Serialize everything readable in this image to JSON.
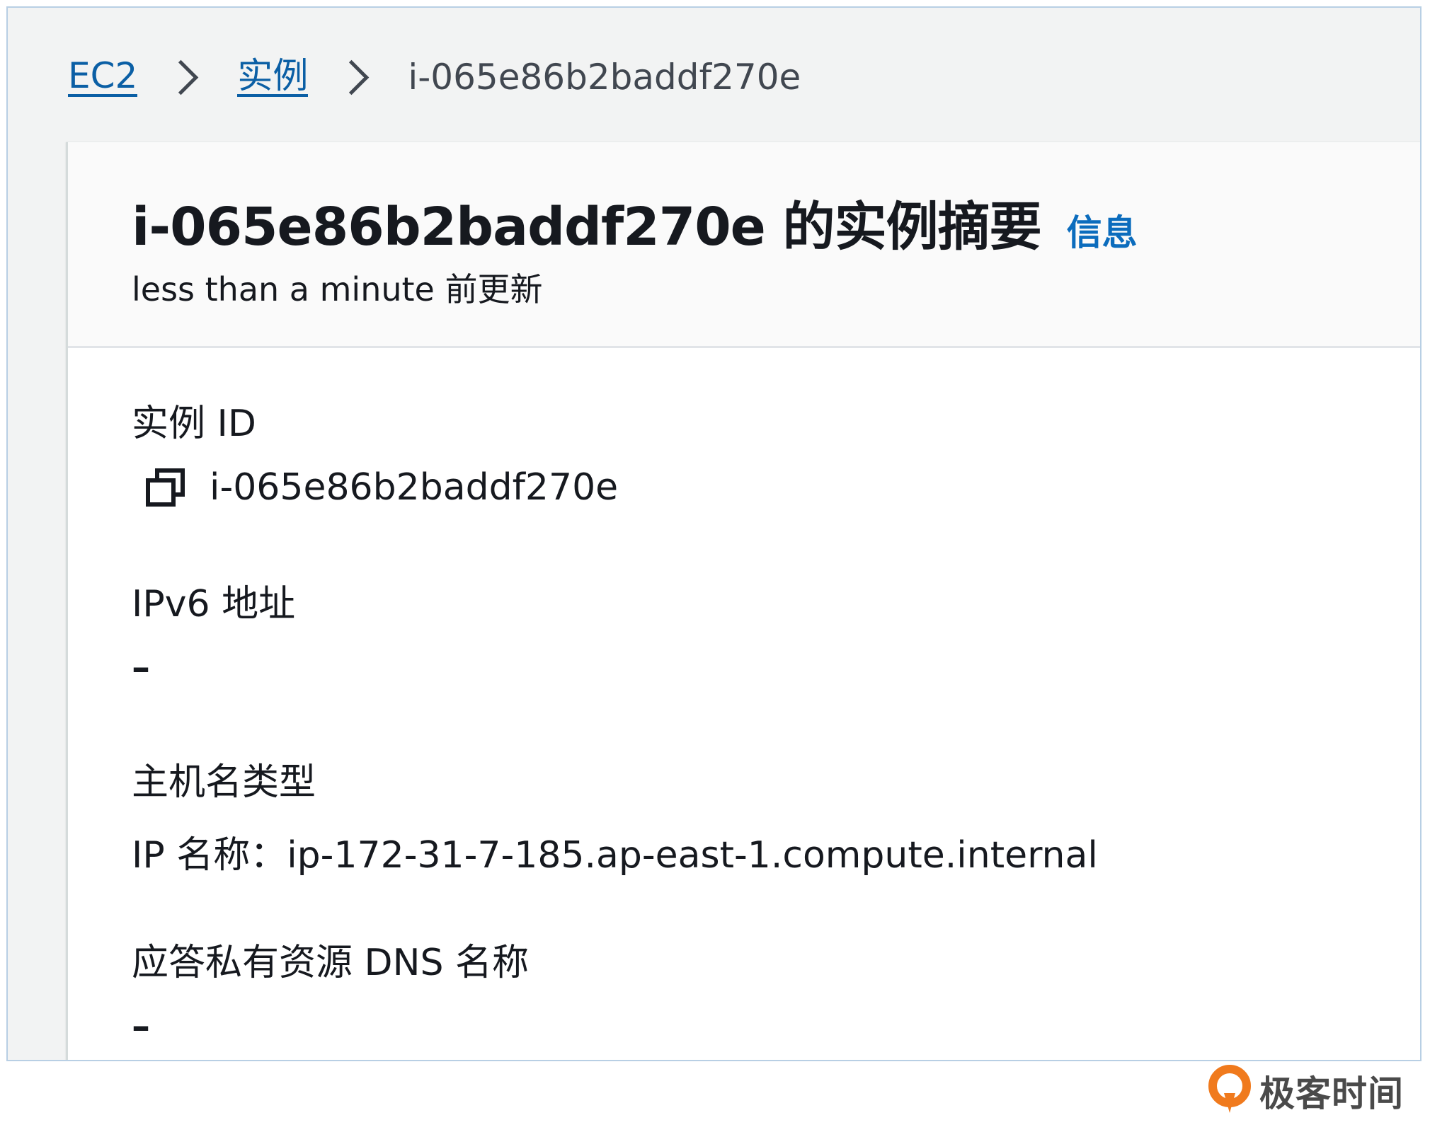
{
  "breadcrumb": {
    "items": [
      {
        "label": "EC2"
      },
      {
        "label": "实例"
      }
    ],
    "current": "i-065e86b2baddf270e"
  },
  "summary": {
    "title": "i-065e86b2baddf270e 的实例摘要",
    "info_link": "信息",
    "updated": "less than a minute 前更新"
  },
  "fields": {
    "instance_id": {
      "label": "实例 ID",
      "value": "i-065e86b2baddf270e",
      "icon": "copy-icon"
    },
    "ipv6": {
      "label": "IPv6 地址",
      "value": "–"
    },
    "hostname_type": {
      "label": "主机名类型",
      "value": "IP 名称：ip-172-31-7-185.ap-east-1.compute.internal"
    },
    "dns_name": {
      "label": "应答私有资源 DNS 名称",
      "value": "–"
    }
  },
  "watermark": {
    "text": "极客时间"
  },
  "colors": {
    "link": "#0b5fa5",
    "info": "#0b6cbd",
    "text": "#16191f",
    "page_bg": "#f2f3f3",
    "logo_orange": "#f07a1d"
  }
}
